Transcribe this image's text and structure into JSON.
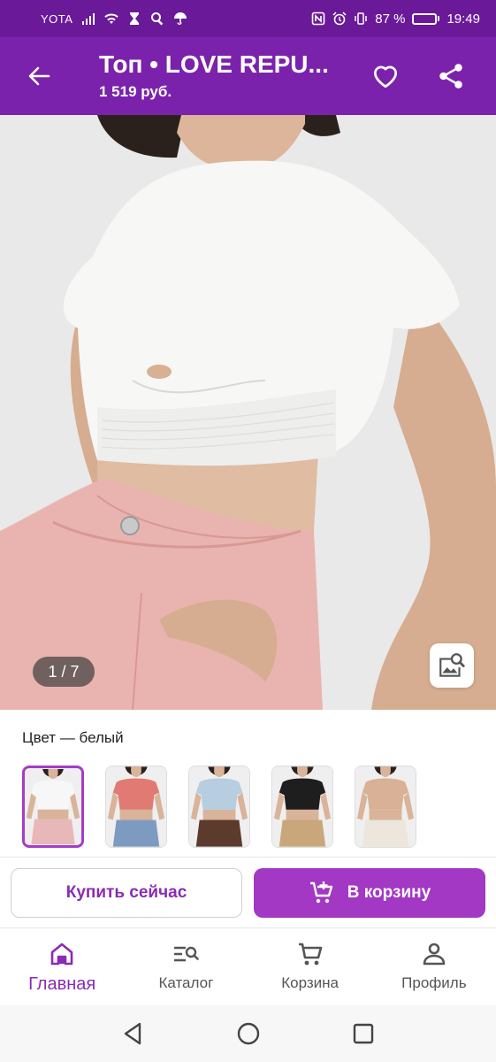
{
  "status_bar": {
    "carrier": "YOTA",
    "battery_percent_label": "87 %",
    "battery_level": 0.87,
    "time": "19:49"
  },
  "app_bar": {
    "title": "Топ • LOVE REPU...",
    "price": "1 519 руб."
  },
  "gallery": {
    "page_indicator": "1 / 7"
  },
  "color": {
    "label": "Цвет — белый",
    "swatches": [
      {
        "name": "white",
        "top_color": "#f7f7f7",
        "bottom_color": "#e8b7b7",
        "skin": "#d9b39a",
        "selected": true
      },
      {
        "name": "coral",
        "top_color": "#e07a72",
        "bottom_color": "#7d9bc1",
        "skin": "#d9b39a",
        "selected": false
      },
      {
        "name": "light-blue",
        "top_color": "#b7cde0",
        "bottom_color": "#5c3a2c",
        "skin": "#d9b39a",
        "selected": false
      },
      {
        "name": "black",
        "top_color": "#1e1e1e",
        "bottom_color": "#c9a77a",
        "skin": "#d9b39a",
        "selected": false
      },
      {
        "name": "beige",
        "top_color": "#d9b197",
        "bottom_color": "#ece6dc",
        "skin": "#d9b39a",
        "selected": false
      }
    ]
  },
  "actions": {
    "buy_now": "Купить сейчас",
    "to_cart": "В корзину"
  },
  "bottom_nav": {
    "items": [
      {
        "label": "Главная",
        "icon": "home-icon",
        "active": true
      },
      {
        "label": "Каталог",
        "icon": "catalog-search-icon",
        "active": false
      },
      {
        "label": "Корзина",
        "icon": "cart-icon",
        "active": false
      },
      {
        "label": "Профиль",
        "icon": "profile-icon",
        "active": false
      }
    ]
  },
  "colors": {
    "status_bar": "#6a1a99",
    "app_bar": "#7b22ac",
    "accent": "#a238c4",
    "accent_text": "#8a2bb5"
  }
}
